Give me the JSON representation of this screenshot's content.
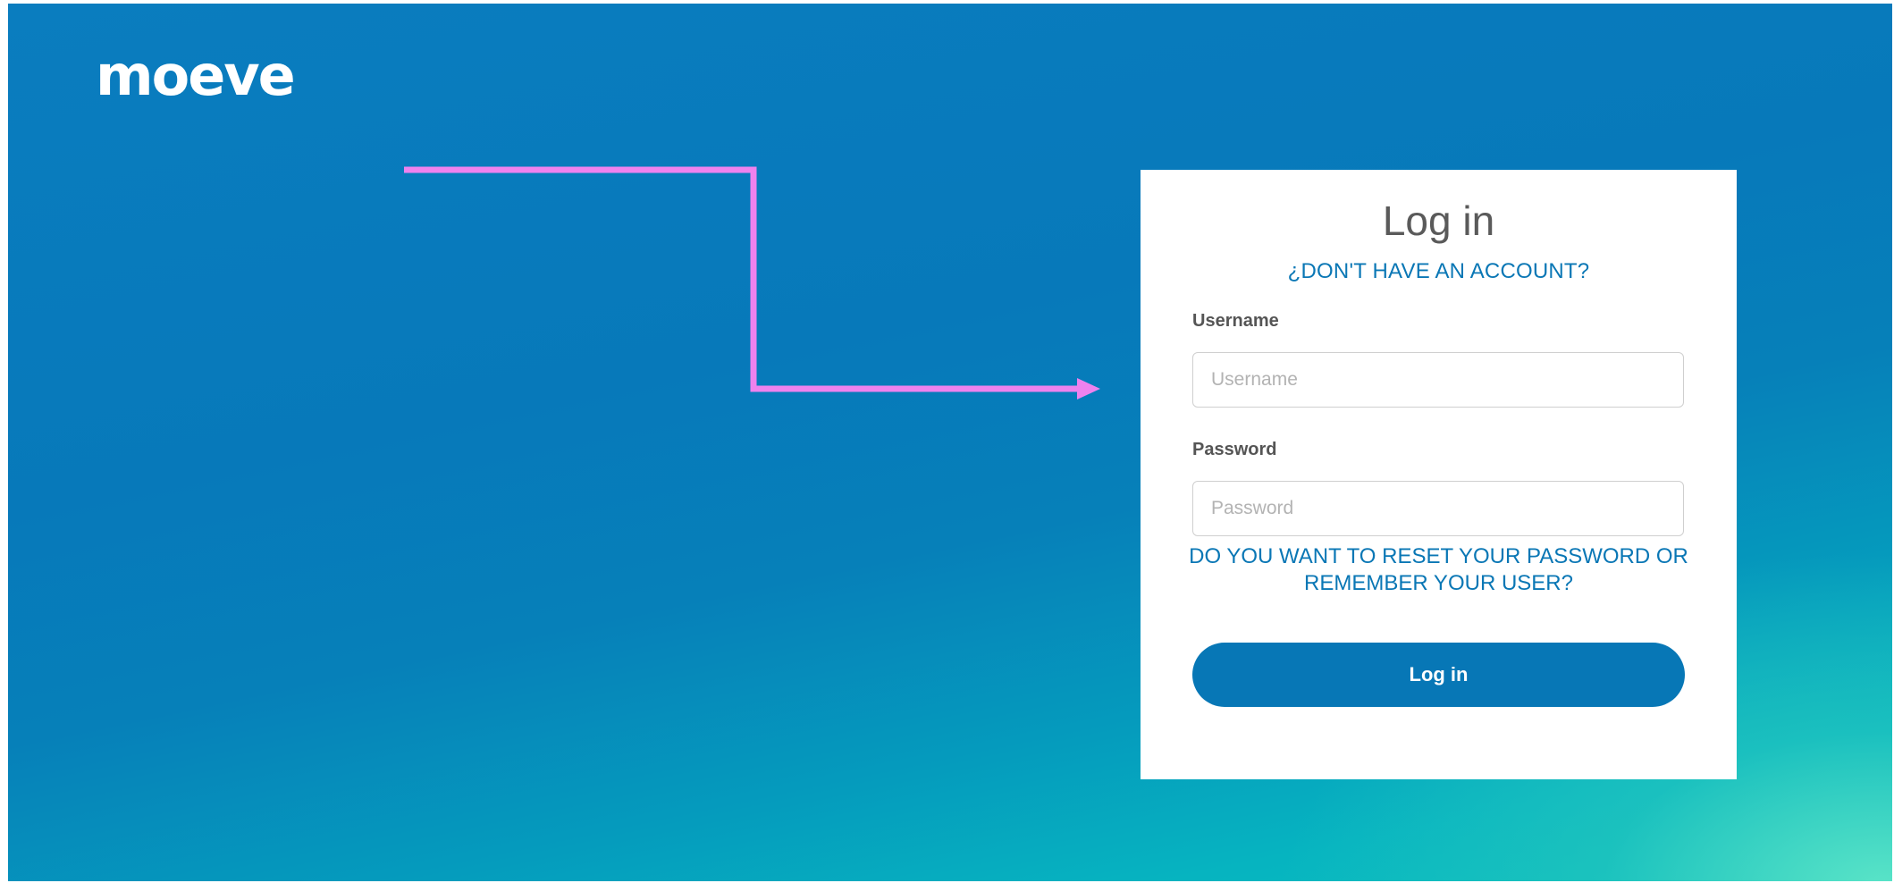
{
  "brand": {
    "logo_text": "moeve"
  },
  "colors": {
    "accent": "#0777b6",
    "link": "#0a77b5",
    "annotation_arrow": "#ee82ee"
  },
  "annotation": {
    "icon": "arrow-right-icon"
  },
  "login": {
    "title": "Log in",
    "signup_link": "¿DON'T HAVE AN ACCOUNT?",
    "username_label": "Username",
    "username_placeholder": "Username",
    "username_value": "",
    "password_label": "Password",
    "password_placeholder": "Password",
    "password_value": "",
    "reset_link": "DO YOU WANT TO RESET YOUR PASSWORD OR REMEMBER YOUR USER?",
    "submit_label": "Log in"
  }
}
